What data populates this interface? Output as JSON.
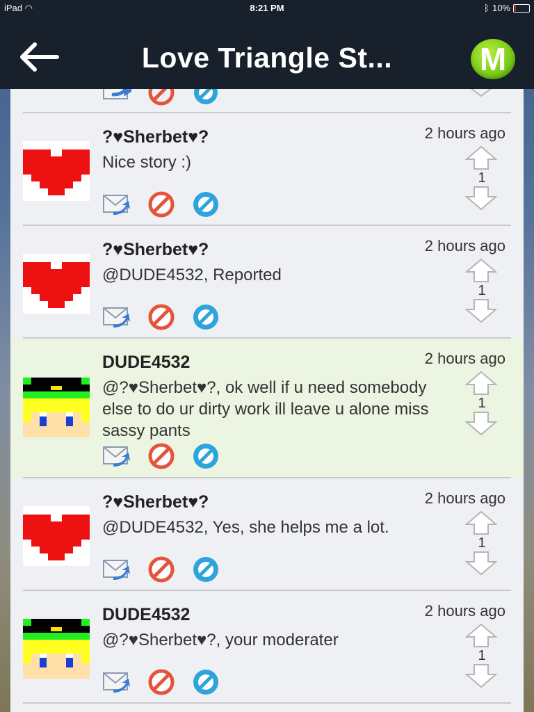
{
  "status_bar": {
    "device": "iPad",
    "time": "8:21 PM",
    "battery": "10%",
    "battery_level": 0.1
  },
  "nav": {
    "title": "Love Triangle St...",
    "logo_letter": "M"
  },
  "comments": [
    {
      "username": "?♥Sherbet♥?",
      "timestamp": "2 hours ago",
      "text": "Nice story :)",
      "votes": "1",
      "avatar": "red-heart-avatar"
    },
    {
      "username": "?♥Sherbet♥?",
      "timestamp": "2 hours ago",
      "text": "@DUDE4532, Reported",
      "votes": "1",
      "avatar": "red-heart-avatar"
    },
    {
      "username": "DUDE4532",
      "timestamp": "2 hours ago",
      "text": "@?♥Sherbet♥?, ok well if u need somebody else to do ur dirty work ill leave u alone miss sassy pants",
      "votes": "1",
      "avatar": "pixel-face-avatar",
      "highlighted": true
    },
    {
      "username": "?♥Sherbet♥?",
      "timestamp": "2 hours ago",
      "text": "@DUDE4532, Yes, she helps me a lot.",
      "votes": "1",
      "avatar": "red-heart-avatar"
    },
    {
      "username": "DUDE4532",
      "timestamp": "2 hours ago",
      "text": "@?♥Sherbet♥?, your moderater",
      "votes": "1",
      "avatar": "pixel-face-avatar"
    }
  ],
  "icons": {
    "reply": "reply-envelope-icon",
    "report": "report-no-icon",
    "block": "block-slash-icon",
    "up": "upvote-arrow-icon",
    "down": "downvote-arrow-icon"
  },
  "colors": {
    "highlight_row": "#ecf5e1",
    "nav_bg": "#17202b",
    "logo_green": "#7ccf1a"
  }
}
